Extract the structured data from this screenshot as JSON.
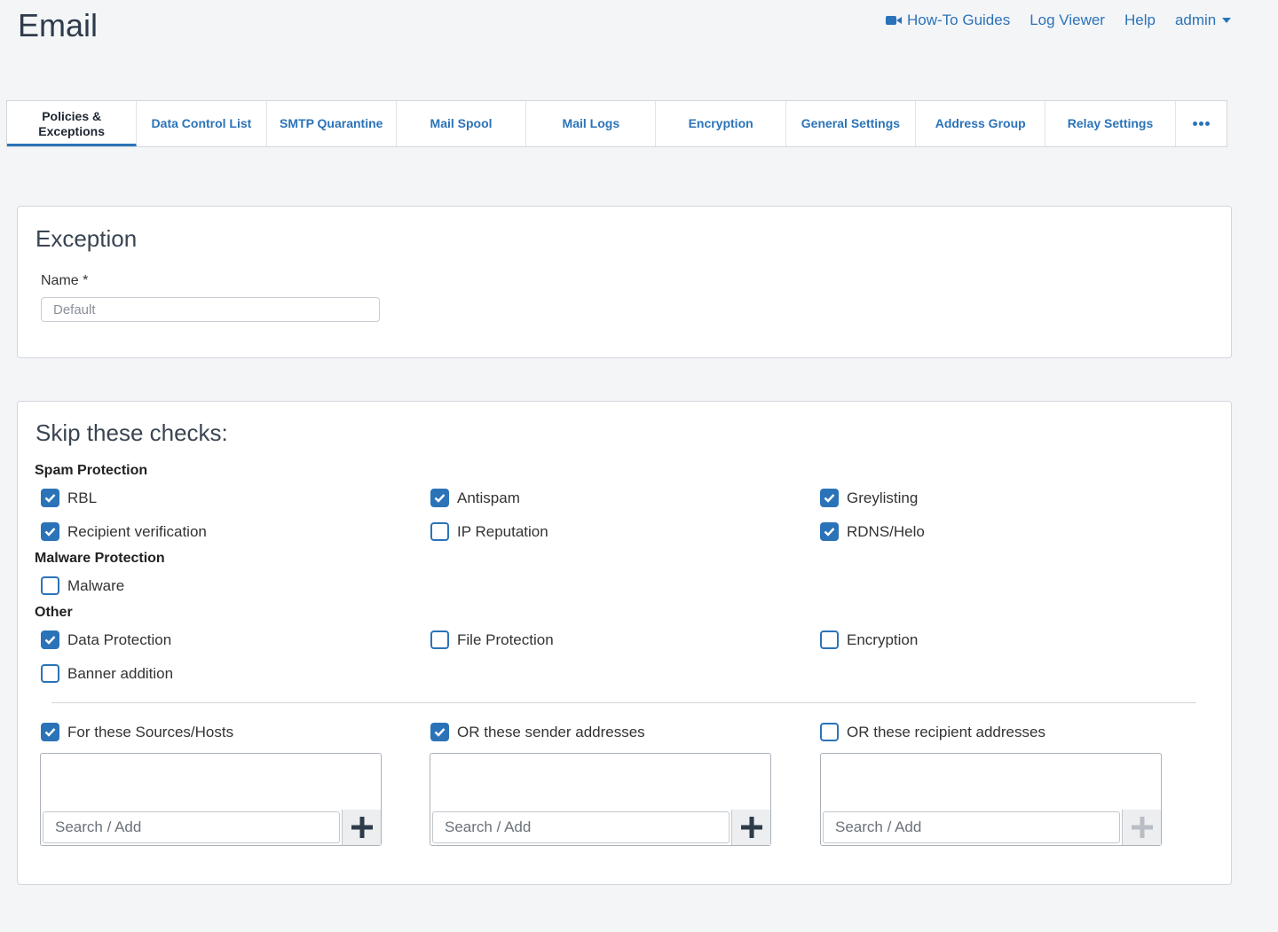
{
  "header": {
    "title": "Email",
    "links": {
      "howto": "How-To Guides",
      "logviewer": "Log Viewer",
      "help": "Help",
      "user": "admin"
    }
  },
  "tabs": [
    {
      "label": "Policies & Exceptions",
      "active": true
    },
    {
      "label": "Data Control List"
    },
    {
      "label": "SMTP Quarantine"
    },
    {
      "label": "Mail Spool"
    },
    {
      "label": "Mail Logs"
    },
    {
      "label": "Encryption"
    },
    {
      "label": "General Settings"
    },
    {
      "label": "Address Group"
    },
    {
      "label": "Relay Settings"
    }
  ],
  "exception": {
    "heading": "Exception",
    "name_label": "Name *",
    "name_placeholder": "Default"
  },
  "skip": {
    "heading": "Skip these checks:",
    "spam": {
      "label": "Spam Protection",
      "rbl": "RBL",
      "antispam": "Antispam",
      "greylisting": "Greylisting",
      "recipient_verification": "Recipient verification",
      "ip_reputation": "IP Reputation",
      "rdns": "RDNS/Helo"
    },
    "malware": {
      "label": "Malware Protection",
      "malware": "Malware"
    },
    "other": {
      "label": "Other",
      "data_protection": "Data Protection",
      "file_protection": "File Protection",
      "encryption": "Encryption",
      "banner": "Banner addition"
    }
  },
  "scope": {
    "sources": "For these Sources/Hosts",
    "senders": "OR these sender addresses",
    "recipients": "OR these recipient addresses",
    "search_placeholder": "Search / Add"
  },
  "colors": {
    "accent": "#2b73b8",
    "page_bg": "#f4f5f7"
  }
}
